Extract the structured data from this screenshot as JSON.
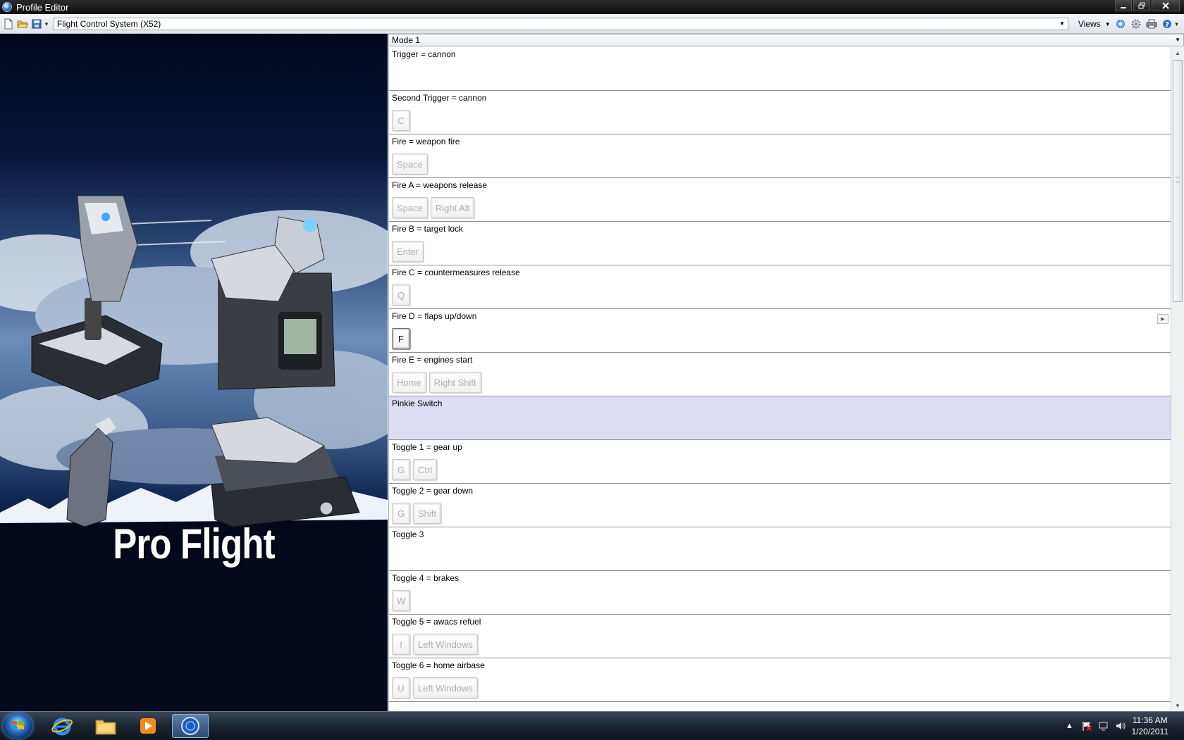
{
  "window": {
    "title": "Profile Editor"
  },
  "toolbar": {
    "profile_value": "Flight Control System (X52)",
    "views_label": "Views"
  },
  "hero": {
    "brand_text": "Pro Flight"
  },
  "mode": {
    "value": "Mode 1"
  },
  "bindings": [
    {
      "label": "Trigger = cannon",
      "keys": []
    },
    {
      "label": "Second Trigger = cannon",
      "keys": [
        "C"
      ]
    },
    {
      "label": "Fire = weapon fire",
      "keys": [
        "Space"
      ]
    },
    {
      "label": "Fire A = weapons release",
      "keys": [
        "Space",
        "Right Alt"
      ]
    },
    {
      "label": "Fire B = target lock",
      "keys": [
        "Enter"
      ]
    },
    {
      "label": "Fire C = countermeasures release",
      "keys": [
        "Q"
      ]
    },
    {
      "label": "Fire D = flaps up/down",
      "keys": [
        "F"
      ]
    },
    {
      "label": "Fire E = engines start",
      "keys": [
        "Home",
        "Right Shift"
      ]
    },
    {
      "label": "Pinkie Switch",
      "keys": []
    },
    {
      "label": "Toggle 1 = gear up",
      "keys": [
        "G",
        "Ctrl"
      ]
    },
    {
      "label": "Toggle 2 = gear down",
      "keys": [
        "G",
        "Shift"
      ]
    },
    {
      "label": "Toggle 3",
      "keys": []
    },
    {
      "label": "Toggle 4 = brakes",
      "keys": [
        "W"
      ]
    },
    {
      "label": "Toggle 5 = awacs refuel",
      "keys": [
        "I",
        "Left Windows"
      ]
    },
    {
      "label": "Toggle 6 = home airbase",
      "keys": [
        "U",
        "Left Windows"
      ]
    }
  ],
  "selected_row_index": 8,
  "active_key_row_index": 6,
  "taskbar": {
    "time": "11:36 AM",
    "date": "1/20/2011"
  },
  "colors": {
    "selected_row": "#dcdcf4",
    "titlebar": "#1a1a1a",
    "taskbar": "#1b2431"
  }
}
